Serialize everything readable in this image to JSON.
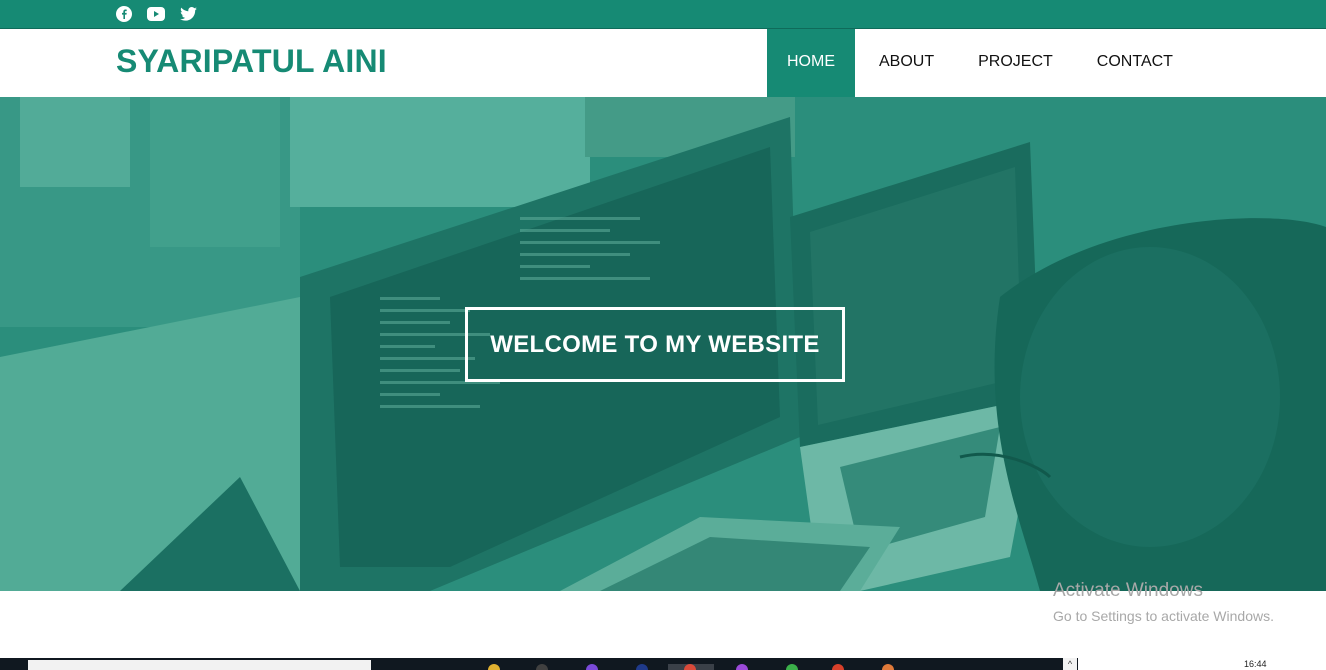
{
  "social": {
    "icons": [
      "facebook-icon",
      "youtube-icon",
      "twitter-icon"
    ]
  },
  "header": {
    "brand": "SYARIPATUL AINI",
    "nav": [
      "HOME",
      "ABOUT",
      "PROJECT",
      "CONTACT"
    ],
    "active": "HOME"
  },
  "hero": {
    "title": "WELCOME TO MY WEBSITE"
  },
  "watermark": {
    "line1": "Activate Windows",
    "line2": "Go to Settings to activate Windows."
  },
  "taskbar": {
    "time": "16:44"
  },
  "colors": {
    "accent": "#168a74",
    "overlay": "#1a8a72"
  }
}
